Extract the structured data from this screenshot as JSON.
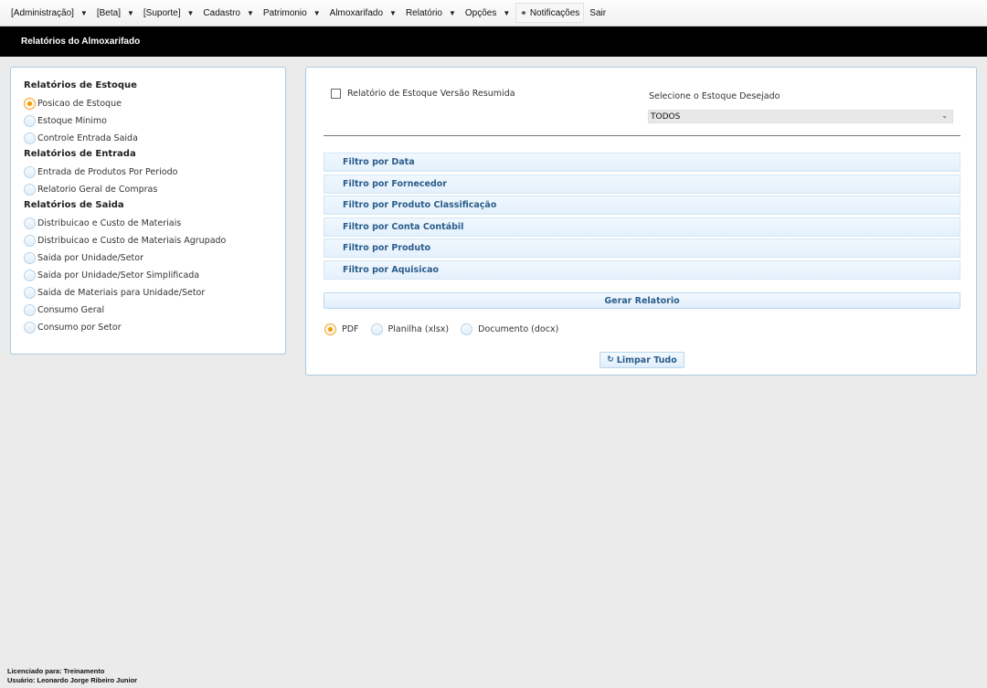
{
  "menu": {
    "items": [
      {
        "label": "[Administração]",
        "caret": "▼"
      },
      {
        "label": "[Beta]",
        "caret": "▼"
      },
      {
        "label": "[Suporte]",
        "caret": "▼"
      },
      {
        "label": "Cadastro",
        "caret": "▼"
      },
      {
        "label": "Patrimonio",
        "caret": "▼"
      },
      {
        "label": "Almoxarifado",
        "caret": "▼"
      },
      {
        "label": "Relatório",
        "caret": "▼"
      },
      {
        "label": "Opções",
        "caret": "▼"
      }
    ],
    "notifications_label": "Notificações",
    "notifications_icon": "bell-icon",
    "logout_label": "Sair"
  },
  "page": {
    "title": "Relatórios do Almoxarifado"
  },
  "left": {
    "groups": [
      {
        "title": "Relatórios de Estoque",
        "options": [
          {
            "label": "Posicao de Estoque",
            "checked": true
          },
          {
            "label": "Estoque Minimo",
            "checked": false
          },
          {
            "label": "Controle Entrada Saida",
            "checked": false
          }
        ]
      },
      {
        "title": "Relatórios de Entrada",
        "options": [
          {
            "label": "Entrada de Produtos Por Periodo",
            "checked": false
          },
          {
            "label": "Relatorio Geral de Compras",
            "checked": false
          }
        ]
      },
      {
        "title": "Relatórios de Saida",
        "options": [
          {
            "label": "Distribuicao e Custo de Materiais",
            "checked": false
          },
          {
            "label": "Distribuicao e Custo de Materiais Agrupado",
            "checked": false
          },
          {
            "label": "Saida por Unidade/Setor",
            "checked": false
          },
          {
            "label": "Saida por Unidade/Setor Simplificada",
            "checked": false
          },
          {
            "label": "Saida de Materiais para Unidade/Setor",
            "checked": false
          },
          {
            "label": "Consumo Geral",
            "checked": false
          },
          {
            "label": "Consumo por Setor",
            "checked": false
          }
        ]
      }
    ]
  },
  "right": {
    "summary_checkbox_label": "Relatório de Estoque Versão Resumida",
    "summary_checked": false,
    "stock_label": "Selecione o Estoque Desejado",
    "stock_value": "TODOS",
    "filters": [
      "Filtro por Data",
      "Filtro por Fornecedor",
      "Filtro por Produto Classificação",
      "Filtro por Conta Contábil",
      "Filtro por Produto",
      "Filtro por Aquisicao"
    ],
    "generate_label": "Gerar Relatorio",
    "formats": [
      {
        "label": "PDF",
        "checked": true
      },
      {
        "label": "Planilha (xlsx)",
        "checked": false
      },
      {
        "label": "Documento (docx)",
        "checked": false
      }
    ],
    "clear_label": "Limpar Tudo",
    "clear_icon": "refresh-icon"
  },
  "footer": {
    "license": "Licenciado para: Treinamento",
    "user": "Usuário: Leonardo Jorge Ribeiro Junior"
  }
}
